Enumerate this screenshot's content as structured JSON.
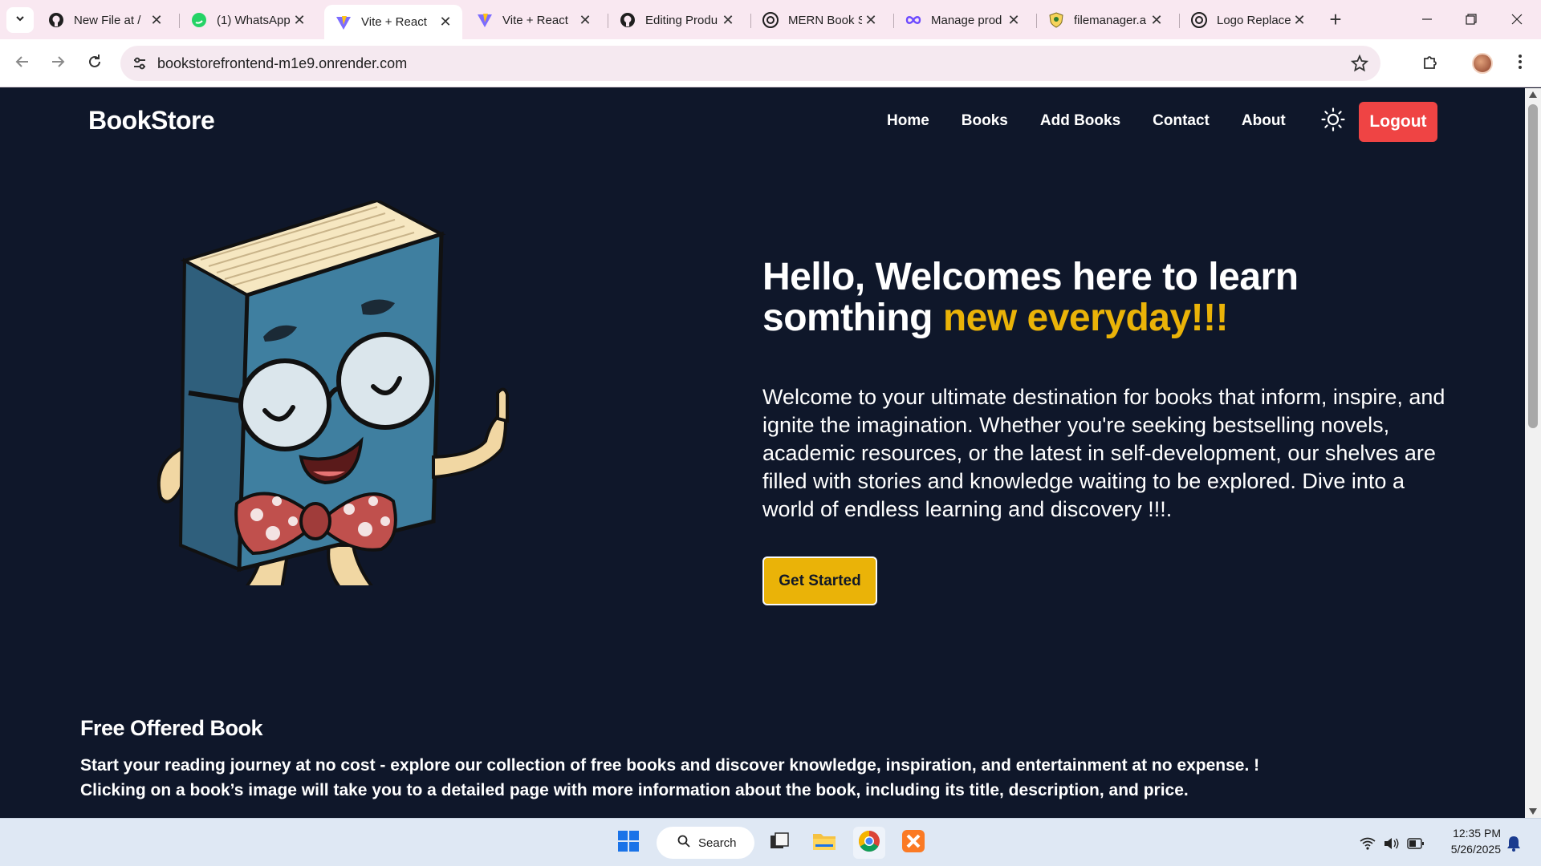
{
  "browser": {
    "tabs": [
      {
        "title": "New File at /",
        "favicon": "github-icon",
        "active": false
      },
      {
        "title": "(1) WhatsApp",
        "favicon": "whatsapp-icon",
        "active": false
      },
      {
        "title": "Vite + React",
        "favicon": "vite-icon",
        "active": true
      },
      {
        "title": "Vite + React",
        "favicon": "vite-icon",
        "active": false
      },
      {
        "title": "Editing Produ",
        "favicon": "github-icon",
        "active": false
      },
      {
        "title": "MERN Book S",
        "favicon": "openai-icon",
        "active": false
      },
      {
        "title": "Manage prod",
        "favicon": "infinity-icon",
        "active": false
      },
      {
        "title": "filemanager.a",
        "favicon": "shield-icon",
        "active": false
      },
      {
        "title": "Logo Replace",
        "favicon": "openai-icon",
        "active": false
      }
    ],
    "address": "bookstorefrontend-m1e9.onrender.com"
  },
  "site": {
    "logo": "BookStore",
    "nav": [
      "Home",
      "Books",
      "Add Books",
      "Contact",
      "About"
    ],
    "logout_label": "Logout"
  },
  "hero": {
    "title_line1": "Hello, Welcomes here to learn",
    "title_line2_plain": "somthing ",
    "title_line2_accent": "new everyday!!!",
    "description": "Welcome to your ultimate destination for books that inform, inspire, and ignite the imagination. Whether you're seeking bestselling novels, academic resources, or the latest in self-development, our shelves are filled with stories and knowledge waiting to be explored. Dive into a world of endless learning and discovery !!!.",
    "cta_label": "Get Started"
  },
  "free_section": {
    "heading": "Free Offered Book",
    "line1": "Start your reading journey at no cost - explore our collection of free books and discover knowledge, inspiration, and entertainment at no expense. !",
    "line2": "Clicking on a book’s image will take you to a detailed page with more information about the book, including its title, description, and price."
  },
  "taskbar": {
    "search_label": "Search",
    "time": "12:35 PM",
    "date": "5/26/2025"
  },
  "colors": {
    "page_bg": "#0f172a",
    "accent_yellow": "#eab308",
    "logout_red": "#ef4444",
    "tab_strip": "#f9e8f1"
  }
}
